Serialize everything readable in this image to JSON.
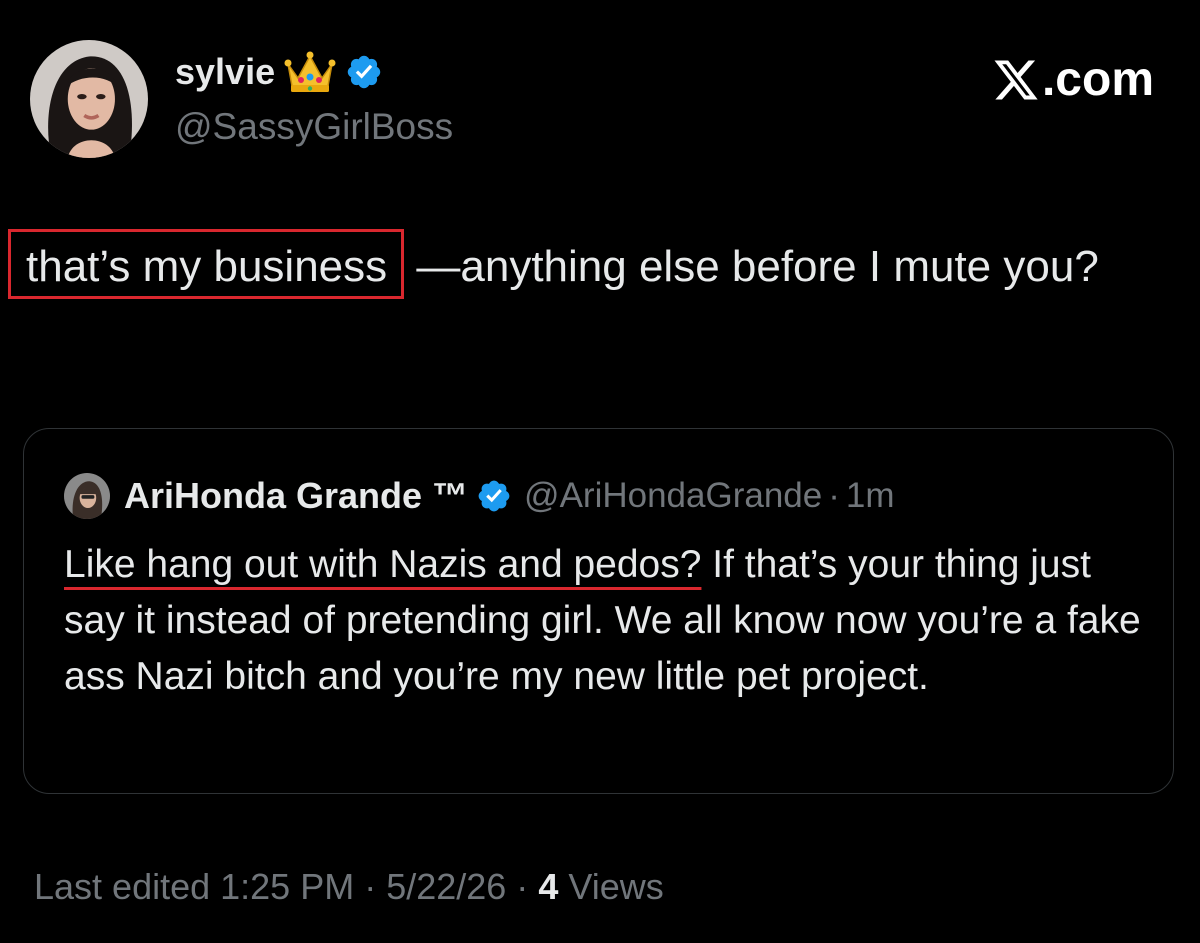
{
  "author": {
    "display_name": "sylvie",
    "handle": "@SassyGirlBoss",
    "crown_icon": "crown-emoji",
    "verified_icon": "verified-badge-icon",
    "verified_color": "#1d9bf0"
  },
  "brand": {
    "text": ".com",
    "logo_icon": "x-logo-icon"
  },
  "tweet": {
    "highlighted_text": "that’s my business",
    "rest_text": "—anything else before I mute you?",
    "highlight_color": "#d9272e"
  },
  "quote": {
    "author_name": "AriHonda Grande ™",
    "handle": "@AriHondaGrande",
    "separator": "·",
    "time": "1m",
    "underlined_text": "Like hang out with Nazis and pedos?",
    "rest_text": " If that’s your thing just say it instead of pretending girl. We all know now you’re a fake ass Nazi bitch and you’re my new little pet project."
  },
  "footer": {
    "edited_label": "Last edited 1:25 PM · 5/22/26 · ",
    "views_count": "4",
    "views_label": " Views"
  }
}
